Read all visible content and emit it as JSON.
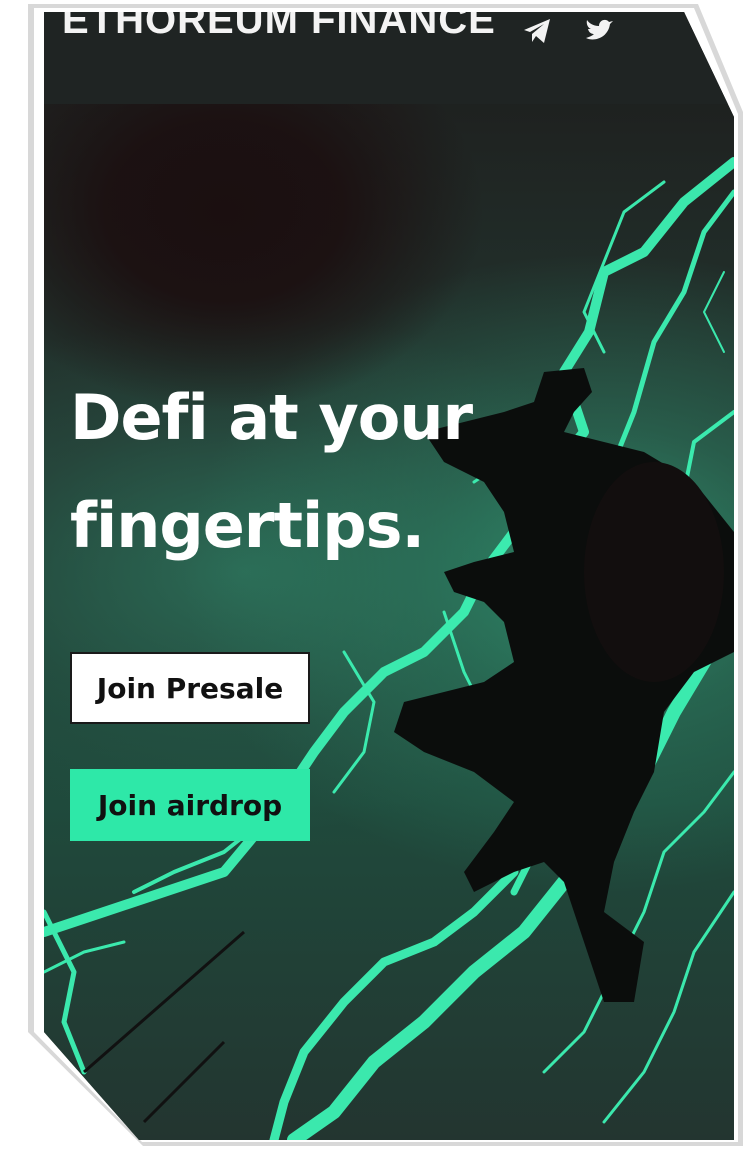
{
  "header": {
    "brand": "ETHOREUM FINANCE",
    "icons": [
      "telegram-icon",
      "twitter-icon"
    ]
  },
  "hero": {
    "title_line1": "Defi at your",
    "title_line2": "fingertips."
  },
  "buttons": {
    "presale_label": "Join Presale",
    "airdrop_label": "Join airdrop"
  },
  "colors": {
    "accent": "#2ee8a8",
    "lightning": "#3df2b4",
    "topbar": "#1f2423",
    "background_dark": "#1a2a24"
  }
}
